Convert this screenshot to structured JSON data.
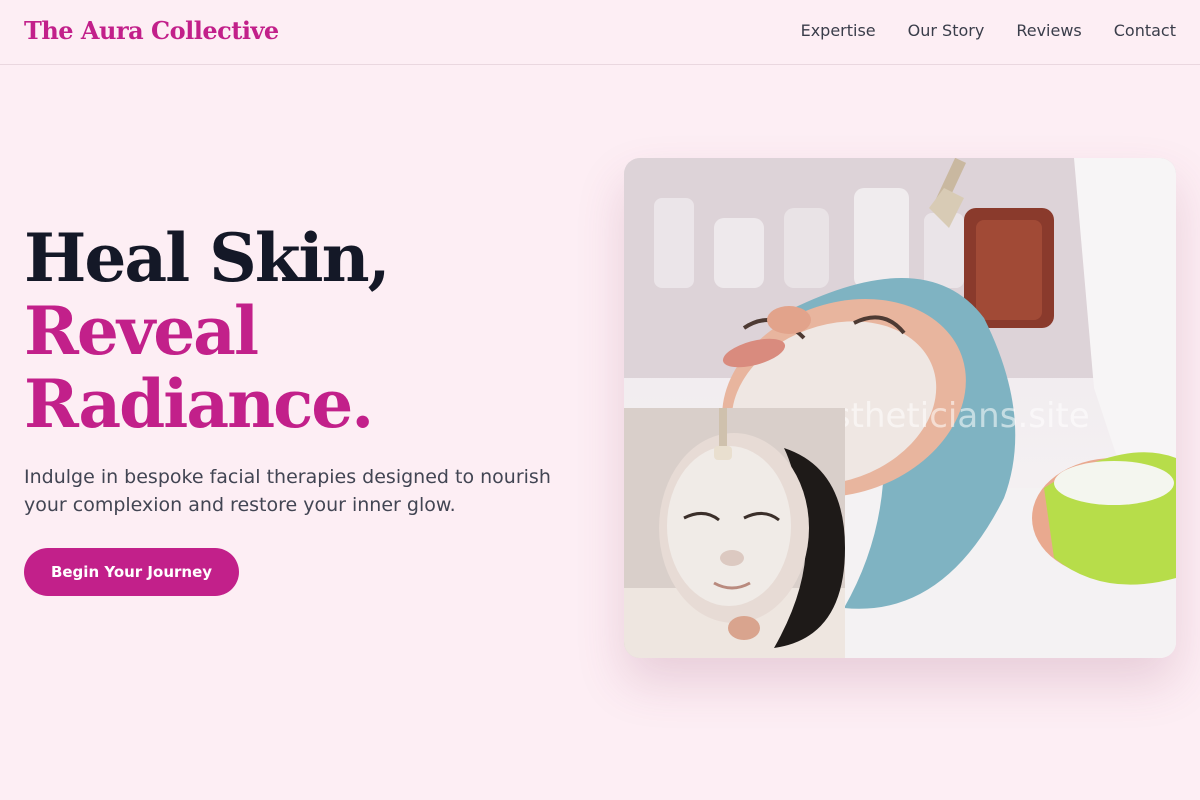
{
  "brand": {
    "name": "The Aura Collective"
  },
  "nav": {
    "links": [
      "Expertise",
      "Our Story",
      "Reviews",
      "Contact"
    ]
  },
  "hero": {
    "headline_line1": "Heal Skin,",
    "headline_line2": "Reveal",
    "headline_line3": "Radiance.",
    "subtext": "Indulge in bespoke facial therapies designed to nourish your complexion and restore your inner glow.",
    "cta_label": "Begin Your Journey",
    "image_watermark": "estheticians.site"
  },
  "colors": {
    "background": "#fdeef4",
    "accent": "#c2208a",
    "headline_dark": "#141827",
    "text_muted": "#424553"
  }
}
